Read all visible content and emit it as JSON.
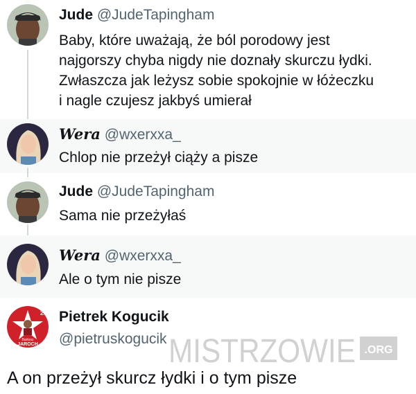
{
  "tweets": [
    {
      "name": "Jude",
      "handle": "@JudeTapingham",
      "lines": [
        "Baby, które uważają, że ból porodowy jest",
        "najgorszy chyba nigdy nie doznały skurczu łydki.",
        "Zwłaszcza jak leżysz sobie spokojnie w łóżeczku",
        "i nagle czujesz jakbyś umierał"
      ]
    },
    {
      "name": "Wera",
      "handle": "@wxerxxa_",
      "lines": [
        "Chlop nie przeżył ciąży a pisze"
      ]
    },
    {
      "name": "Jude",
      "handle": "@JudeTapingham",
      "lines": [
        "Sama nie przeżyłaś"
      ]
    },
    {
      "name": "Wera",
      "handle": "@wxerxxa_",
      "lines": [
        "Ale o tym nie pisze"
      ]
    },
    {
      "name": "Pietrek Kogucik",
      "handle": "@pietruskogucik",
      "avatar_text": {
        "number": "23",
        "line1": "Bartosz",
        "line2": "JAROCH"
      }
    }
  ],
  "caption": "A on przeżył skurcz łydki i o tym pisze",
  "watermark": {
    "main": "MISTRZOWIE",
    "suffix": ".ORG"
  },
  "colors": {
    "text": "#0f1419",
    "handle": "#536471",
    "thread_line": "#cfd9de",
    "shaded_bg": "#f7f9f9",
    "avatar_red": "#d0212a"
  }
}
